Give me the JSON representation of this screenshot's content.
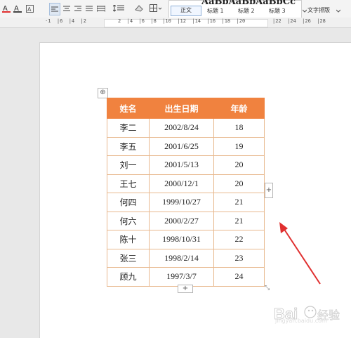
{
  "toolbar": {
    "icons": [
      "font-color-icon",
      "highlight-icon",
      "align-left-icon",
      "align-center-icon",
      "align-right-icon",
      "justify-icon",
      "distributed-icon",
      "line-spacing-icon",
      "shading-icon",
      "border-icon"
    ],
    "style_preview": "AaBbAaBbAaBbCc",
    "styles": [
      "正文",
      "标题 1",
      "标题 2",
      "标题 3"
    ],
    "text_layout": "文字排版"
  },
  "ruler": {
    "left_marks": "·1  |6  |4  |2",
    "middle_marks": "2  |4  |6  |8  |10  |12  |14  |16  |18  |20",
    "right_marks": "|22  |24  |26  |28"
  },
  "table": {
    "headers": [
      "姓名",
      "出生日期",
      "年龄"
    ],
    "rows": [
      [
        "李二",
        "2002/8/24",
        "18"
      ],
      [
        "李五",
        "2001/6/25",
        "19"
      ],
      [
        "刘一",
        "2001/5/13",
        "20"
      ],
      [
        "王七",
        "2000/12/1",
        "20"
      ],
      [
        "何四",
        "1999/10/27",
        "21"
      ],
      [
        "何六",
        "2000/2/27",
        "21"
      ],
      [
        "陈十",
        "1998/10/31",
        "22"
      ],
      [
        "张三",
        "1998/2/14",
        "23"
      ],
      [
        "顾九",
        "1997/3/7",
        "24"
      ]
    ]
  },
  "controls": {
    "move": "⊕",
    "add_col": "+",
    "add_row": "+",
    "resize": "⤡"
  },
  "watermark": {
    "text": "Bai 经验",
    "url": "jingyan.baidu.com"
  },
  "colors": {
    "header_bg": "#f0823f",
    "border": "#e8b98f",
    "arrow": "#e03030"
  }
}
